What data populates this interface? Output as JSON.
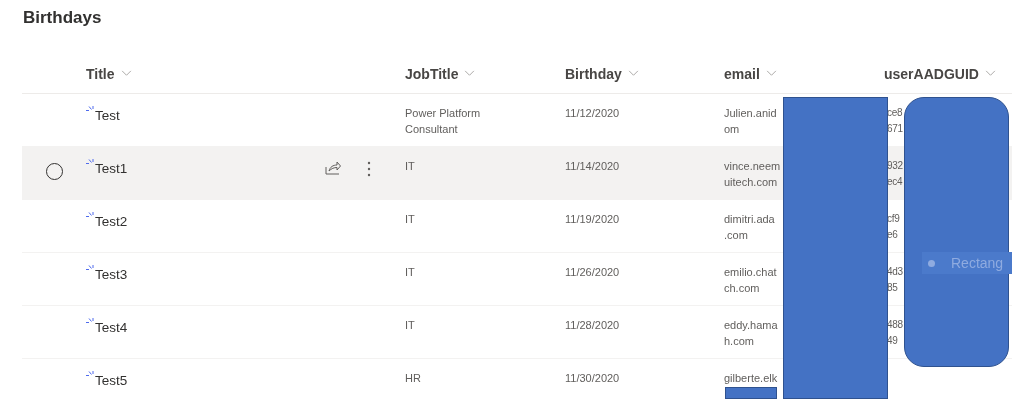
{
  "page": {
    "title": "Birthdays"
  },
  "table": {
    "columns": [
      "Title",
      "JobTitle",
      "Birthday",
      "email",
      "userAADGUID"
    ],
    "rows": [
      {
        "title": "Test",
        "new": true,
        "hovered": false,
        "job": [
          "Power Platform",
          "Consultant"
        ],
        "birthday": "11/12/2020",
        "email": [
          "Julien.anid",
          "om"
        ],
        "guid": [
          "ce8",
          "671"
        ]
      },
      {
        "title": "Test1",
        "new": true,
        "hovered": true,
        "job": [
          "IT"
        ],
        "birthday": "11/14/2020",
        "email": [
          "vince.neem",
          "uitech.com"
        ],
        "guid": [
          "932",
          "ec4"
        ]
      },
      {
        "title": "Test2",
        "new": true,
        "hovered": false,
        "job": [
          "IT"
        ],
        "birthday": "11/19/2020",
        "email": [
          "dimitri.ada",
          ".com"
        ],
        "guid": [
          "cf9",
          "e6"
        ]
      },
      {
        "title": "Test3",
        "new": true,
        "hovered": false,
        "job": [
          "IT"
        ],
        "birthday": "11/26/2020",
        "email": [
          "emilio.chat",
          "ch.com"
        ],
        "guid": [
          "4d3",
          "85"
        ]
      },
      {
        "title": "Test4",
        "new": true,
        "hovered": false,
        "job": [
          "IT"
        ],
        "birthday": "11/28/2020",
        "email": [
          "eddy.hama",
          "h.com"
        ],
        "guid": [
          "488",
          "49"
        ]
      },
      {
        "title": "Test5",
        "new": true,
        "hovered": false,
        "job": [
          "HR"
        ],
        "birthday": "11/30/2020",
        "email": [
          "gilberte.elk"
        ],
        "guid": []
      }
    ]
  },
  "overlays": [
    {
      "kind": "rectangle"
    },
    {
      "kind": "rounded"
    },
    {
      "kind": "small"
    }
  ],
  "overlay_label": {
    "text": "Rectang"
  }
}
